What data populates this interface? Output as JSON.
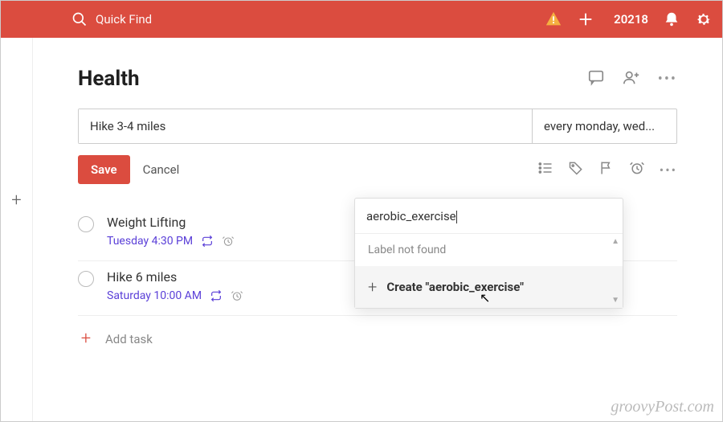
{
  "header": {
    "search_placeholder": "Quick Find",
    "karma_points": "20218"
  },
  "page": {
    "title": "Health"
  },
  "editor": {
    "task_name": "Hike 3-4 miles",
    "date_text": "every monday, wed...",
    "save_label": "Save",
    "cancel_label": "Cancel"
  },
  "tasks": [
    {
      "title": "Weight Lifting",
      "meta": "Tuesday 4:30 PM"
    },
    {
      "title": "Hike 6 miles",
      "meta": "Saturday 10:00 AM"
    }
  ],
  "add_task_label": "Add task",
  "popup": {
    "input_value": "aerobic_exercise",
    "not_found": "Label not found",
    "create_prefix": "Create ",
    "create_name": "\"aerobic_exercise\""
  },
  "watermark": "groovyPost.com"
}
